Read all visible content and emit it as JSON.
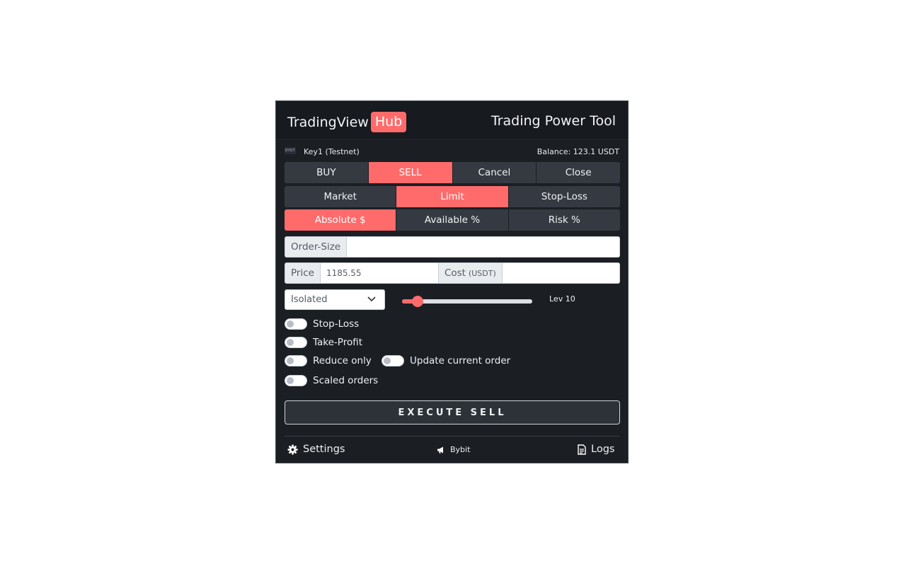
{
  "header": {
    "brand_name": "TradingView",
    "brand_badge": "Hub",
    "tool_title": "Trading Power Tool"
  },
  "account": {
    "logo_text": "BYBIT",
    "name": "Key1 (Testnet)",
    "balance": "Balance: 123.1 USDT"
  },
  "side_buttons": [
    "BUY",
    "SELL",
    "Cancel",
    "Close"
  ],
  "side_active": "SELL",
  "order_types": [
    "Market",
    "Limit",
    "Stop-Loss"
  ],
  "order_type_active": "Limit",
  "size_modes": [
    "Absolute $",
    "Available %",
    "Risk %"
  ],
  "size_mode_active": "Absolute $",
  "order_size": {
    "label": "Order-Size",
    "value": ""
  },
  "price": {
    "label": "Price",
    "value": "1185.55"
  },
  "cost": {
    "label": "Cost",
    "unit": "(USDT)",
    "value": ""
  },
  "margin_mode": {
    "selected": "Isolated"
  },
  "leverage": {
    "label": "Lev 10",
    "fraction": 0.12
  },
  "toggles": {
    "stop_loss": "Stop-Loss",
    "take_profit": "Take-Profit",
    "reduce_only": "Reduce only",
    "update_order": "Update current order",
    "scaled_orders": "Scaled orders"
  },
  "execute_label": "EXECUTE SELL",
  "footer": {
    "settings": "Settings",
    "exchange": "Bybit",
    "logs": "Logs"
  },
  "colors": {
    "accent": "#ff6b6b",
    "panel_bg": "#1b1f24",
    "button_bg": "#353a42"
  }
}
